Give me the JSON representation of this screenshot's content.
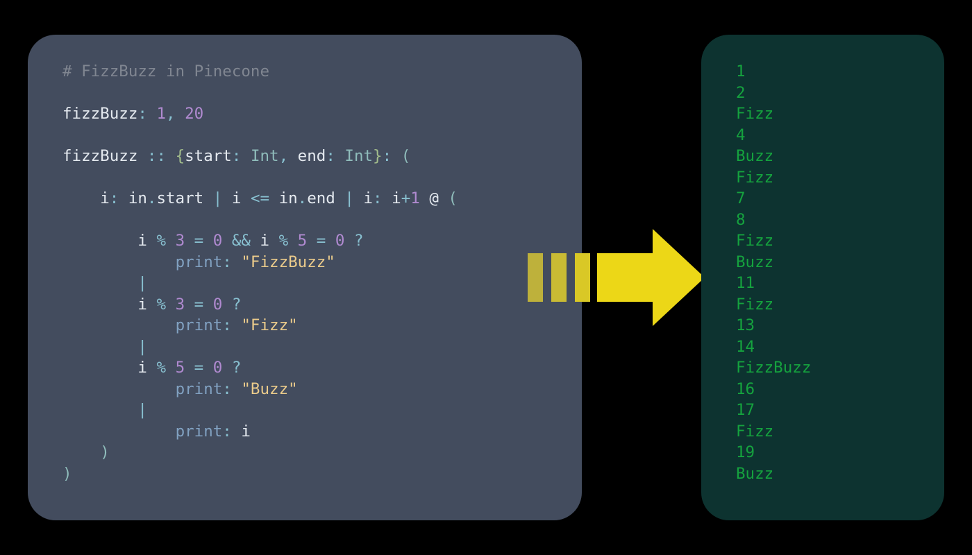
{
  "code": {
    "comment": "# FizzBuzz in Pinecone",
    "call_name": "fizzBuzz",
    "call_args": "1, 20",
    "def_name": "fizzBuzz",
    "def_sig_open": "{",
    "def_param1": "start",
    "def_type1": "Int",
    "def_param2": "end",
    "def_type2": "Int",
    "def_sig_close": "}",
    "loop_var": "i",
    "loop_in": "in",
    "loop_start": "start",
    "loop_end": "end",
    "cond1_fizzbuzz": "\"FizzBuzz\"",
    "cond2_fizz": "\"Fizz\"",
    "cond3_buzz": "\"Buzz\"",
    "print_kw": "print",
    "num_1": "1",
    "num_20": "20",
    "num_3": "3",
    "num_5": "5",
    "num_0": "0",
    "op_colon": ":",
    "op_comma": ",",
    "op_dcolon": "::",
    "op_dot": ".",
    "op_pipe": "|",
    "op_lte": "<=",
    "op_plus": "+",
    "op_at": "@",
    "op_mod": "%",
    "op_eq": "=",
    "op_and": "&&",
    "op_q": "?",
    "paren_open": "(",
    "paren_close": ")"
  },
  "output_lines": [
    "1",
    "2",
    "Fizz",
    "4",
    "Buzz",
    "Fizz",
    "7",
    "8",
    "Fizz",
    "Buzz",
    "11",
    "Fizz",
    "13",
    "14",
    "FizzBuzz",
    "16",
    "17",
    "Fizz",
    "19",
    "Buzz"
  ],
  "colors": {
    "code_bg": "#434c5e",
    "output_bg": "#0d3330",
    "output_fg": "#15a23e",
    "arrow": "#ecd717",
    "arrow_bars": "#beb13b"
  }
}
